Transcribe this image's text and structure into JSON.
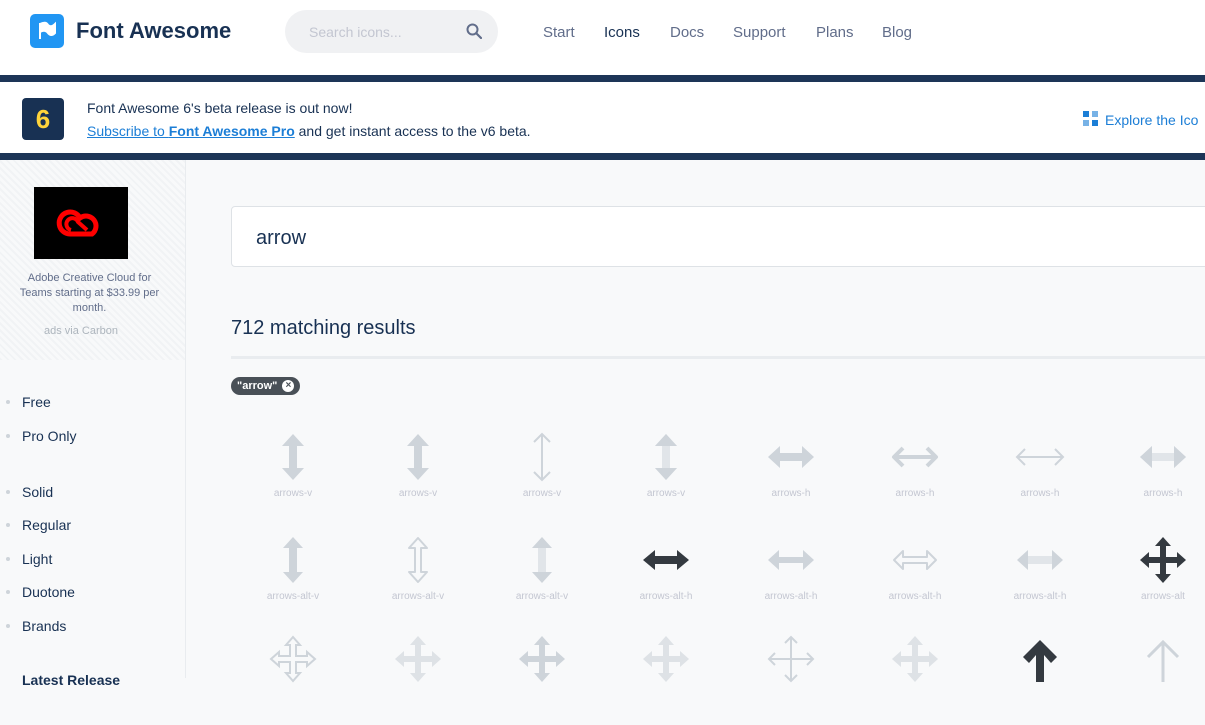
{
  "header": {
    "brand": "Font Awesome",
    "search_placeholder": "Search icons...",
    "nav": [
      "Start",
      "Icons",
      "Docs",
      "Support",
      "Plans",
      "Blog"
    ],
    "active_nav": "Icons"
  },
  "banner": {
    "badge": "6",
    "line1": "Font Awesome 6's beta release is out now!",
    "subscribe_prefix": "Subscribe to ",
    "subscribe_link": "Font Awesome Pro",
    "line2_suffix": " and get instant access to the v6 beta.",
    "explore": "Explore the Ico"
  },
  "ad": {
    "text": "Adobe Creative Cloud for Teams starting at $33.99 per month.",
    "via": "ads via Carbon"
  },
  "sidebar": {
    "license_filters": [
      "Free",
      "Pro Only"
    ],
    "style_filters": [
      "Solid",
      "Regular",
      "Light",
      "Duotone",
      "Brands"
    ],
    "next_heading": "Latest Release"
  },
  "main": {
    "search_value": "arrow",
    "results": "712 matching results",
    "chip": "\"arrow\""
  },
  "icons": [
    [
      "arrows-v",
      "arrows-v",
      "arrows-v",
      "arrows-v",
      "arrows-h",
      "arrows-h",
      "arrows-h",
      "arrows-h"
    ],
    [
      "arrows-alt-v",
      "arrows-alt-v",
      "arrows-alt-v",
      "arrows-alt-h",
      "arrows-alt-h",
      "arrows-alt-h",
      "arrows-alt-h",
      "arrows-alt"
    ]
  ],
  "colors": {
    "brand_blue": "#2196f3",
    "navy": "#183153",
    "link": "#1c7ed6",
    "icon_muted": "#ced4da",
    "icon_dark": "#343a40"
  }
}
